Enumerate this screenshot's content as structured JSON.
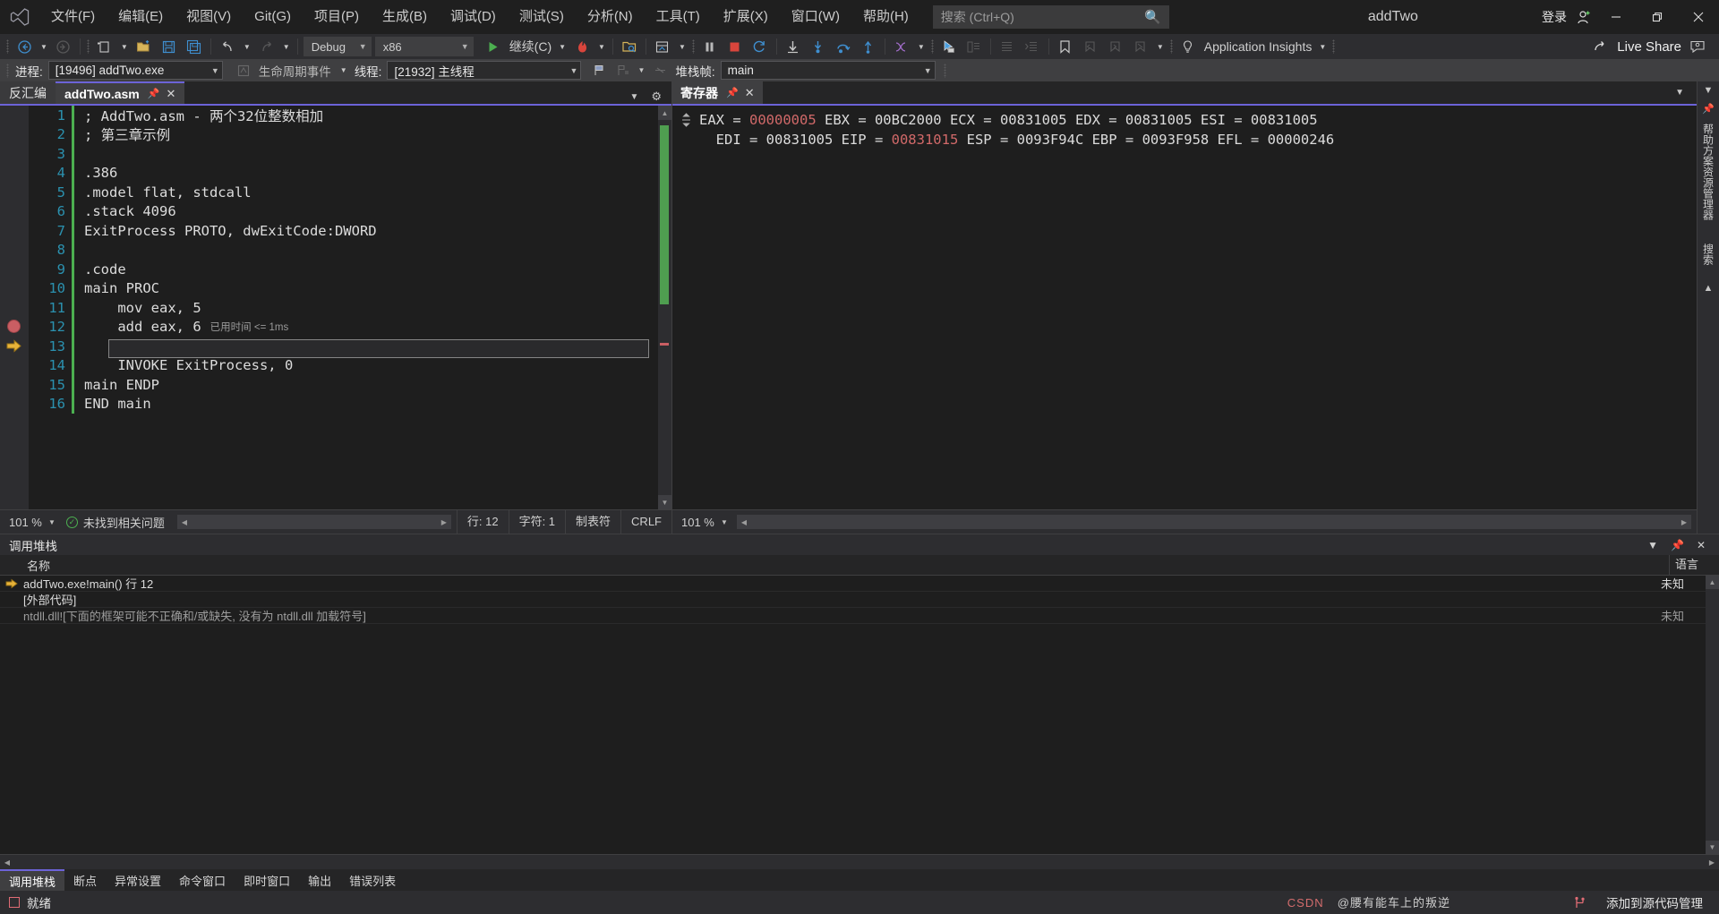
{
  "titlebar": {
    "logo_icon": "visual-studio-logo",
    "menus": [
      "文件(F)",
      "编辑(E)",
      "视图(V)",
      "Git(G)",
      "项目(P)",
      "生成(B)",
      "调试(D)",
      "测试(S)",
      "分析(N)",
      "工具(T)",
      "扩展(X)",
      "窗口(W)",
      "帮助(H)"
    ],
    "search_placeholder": "搜索 (Ctrl+Q)",
    "search_icon": "search-icon",
    "window_title": "addTwo",
    "signin_label": "登录",
    "signin_icon": "add-user-icon",
    "minimize_icon": "minimize-icon",
    "restore_icon": "restore-icon",
    "close_icon": "close-icon"
  },
  "toolbar": {
    "nav_back_icon": "navigate-back-icon",
    "nav_forward_icon": "navigate-forward-icon",
    "new_item_icon": "new-item-icon",
    "open_icon": "open-file-icon",
    "save_icon": "save-icon",
    "save_all_icon": "save-all-icon",
    "undo_icon": "undo-icon",
    "redo_icon": "redo-icon",
    "config_value": "Debug",
    "platform_value": "x86",
    "continue_label": "继续(C)",
    "continue_icon": "play-icon",
    "hotreload_icon": "hot-reload-icon",
    "attach_icon": "attach-process-icon",
    "breakall_icon": "break-all-icon",
    "pause_icon": "pause-icon",
    "stop_icon": "stop-icon",
    "restart_icon": "restart-icon",
    "step_into_icon": "step-into-icon",
    "step_over_icon": "step-over-icon",
    "step_out_icon": "step-out-icon",
    "show_next_icon": "show-next-statement-icon",
    "threads_icon": "threads-icon",
    "cursor_icon": "select-element-icon",
    "live_visual_icon": "live-visual-tree-icon",
    "indent_icon": "indent-icon",
    "outdent_icon": "outdent-icon",
    "bookmark_icon": "bookmark-icon",
    "prev_bookmark_icon": "previous-bookmark-icon",
    "next_bookmark_icon": "next-bookmark-icon",
    "clear_bookmark_icon": "clear-bookmarks-icon",
    "app_insights_label": "Application Insights",
    "app_insights_icon": "lightbulb-icon",
    "live_share_label": "Live Share",
    "live_share_icon": "live-share-icon",
    "feedback_icon": "feedback-icon"
  },
  "debugbar": {
    "process_label": "进程:",
    "process_value": "[19496] addTwo.exe",
    "lifecycle_label": "生命周期事件",
    "lifecycle_icon": "lifecycle-events-icon",
    "thread_label": "线程:",
    "thread_value": "[21932] 主线程",
    "flag_icon": "flag-icon",
    "flag_list_icon": "flag-list-icon",
    "no_flag_icon": "no-flag-icon",
    "stackframe_label": "堆栈帧:",
    "stackframe_value": "main"
  },
  "editor": {
    "tabs": [
      {
        "label": "反汇编",
        "active": false
      },
      {
        "label": "addTwo.asm",
        "active": true,
        "pin_icon": "pin-icon",
        "close_icon": "close-icon"
      }
    ],
    "tab_dropdown_icon": "chevron-down-icon",
    "tab_settings_icon": "gear-icon",
    "lines": [
      {
        "n": "1",
        "text": "; AddTwo.asm - 两个32位整数相加",
        "changed": true
      },
      {
        "n": "2",
        "text": "; 第三章示例",
        "changed": true
      },
      {
        "n": "3",
        "text": "",
        "changed": true
      },
      {
        "n": "4",
        "text": ".386",
        "changed": true
      },
      {
        "n": "5",
        "text": ".model flat, stdcall",
        "changed": true
      },
      {
        "n": "6",
        "text": ".stack 4096",
        "changed": true
      },
      {
        "n": "7",
        "text": "ExitProcess PROTO, dwExitCode:DWORD",
        "changed": true
      },
      {
        "n": "8",
        "text": "",
        "changed": true
      },
      {
        "n": "9",
        "text": ".code",
        "changed": true
      },
      {
        "n": "10",
        "text": "main PROC",
        "changed": true
      },
      {
        "n": "11",
        "text": "    mov eax, 5",
        "changed": true,
        "breakpoint": true
      },
      {
        "n": "12",
        "text": "    add eax, 6",
        "changed": true,
        "current": true,
        "annotation": "已用时间 <= 1ms"
      },
      {
        "n": "13",
        "text": "",
        "changed": true
      },
      {
        "n": "14",
        "text": "    INVOKE ExitProcess, 0",
        "changed": true
      },
      {
        "n": "15",
        "text": "main ENDP",
        "changed": true
      },
      {
        "n": "16",
        "text": "END main",
        "changed": true
      }
    ],
    "breakpoint_icon": "breakpoint-icon",
    "current_statement_icon": "current-statement-arrow-icon",
    "status": {
      "zoom": "101 %",
      "zoom_arrow_icon": "chevron-down-icon",
      "problems": "未找到相关问题",
      "problems_icon": "check-circle-icon",
      "line": "行: 12",
      "column": "字符: 1",
      "tabs_mode": "制表符",
      "eol": "CRLF"
    }
  },
  "registers": {
    "tab_label": "寄存器",
    "pin_icon": "pin-icon",
    "close_icon": "close-icon",
    "dropdown_icon": "chevron-down-icon",
    "line1_pre": "EAX = ",
    "line1_eax": "00000005",
    "line1_post": " EBX = 00BC2000 ECX = 00831005 EDX = 00831005 ESI = 00831005",
    "line2_pre": "  EDI = 00831005 EIP = ",
    "line2_eip": "00831015",
    "line2_post": " ESP = 0093F94C EBP = 0093F958 EFL = 00000246",
    "resize_icon": "resize-grip-icon",
    "zoom": "101 %",
    "zoom_arrow_icon": "chevron-down-icon"
  },
  "right_dock": {
    "tabs": [
      "帮助方案资源管理器",
      "搜索"
    ],
    "collapse_icon": "chevron-down-icon",
    "pin_icon": "pin-icon",
    "up_icon": "chevron-up-icon"
  },
  "callstack": {
    "panel_title": "调用堆栈",
    "minimize_icon": "chevron-down-icon",
    "pin_icon": "pin-icon",
    "close_icon": "close-icon",
    "columns": [
      "名称",
      "语言"
    ],
    "rows": [
      {
        "name": "addTwo.exe!main() 行 12",
        "lang": "未知",
        "current": true
      },
      {
        "name": "[外部代码]",
        "lang": "",
        "current": false
      },
      {
        "name": "ntdll.dll![下面的框架可能不正确和/或缺失, 没有为 ntdll.dll 加载符号]",
        "lang": "未知",
        "current": false,
        "dim": true
      }
    ],
    "current_icon": "current-frame-arrow-icon"
  },
  "dock_tabs": [
    {
      "label": "调用堆栈",
      "active": true
    },
    {
      "label": "断点",
      "active": false
    },
    {
      "label": "异常设置",
      "active": false
    },
    {
      "label": "命令窗口",
      "active": false
    },
    {
      "label": "即时窗口",
      "active": false
    },
    {
      "label": "输出",
      "active": false
    },
    {
      "label": "错误列表",
      "active": false
    }
  ],
  "statusbar": {
    "state": "就绪",
    "state_icon": "stop-square-icon",
    "add_to_source_control": "添加到源代码管理",
    "source_control_icon": "source-control-icon",
    "watermark_left": "CSDN",
    "watermark_right": "@腰有能车上的叛逆"
  },
  "colors": {
    "accent_purple": "#6c63d8",
    "line_number": "#2b91af",
    "changed_bar_green": "#4caf50",
    "breakpoint_red": "#c95e63",
    "register_highlight_red": "#d16969",
    "play_green": "#4caf50",
    "titlebar_bg": "#1f1f1f",
    "toolbar_bg": "#2d2d30",
    "debugbar_bg": "#3f3f41",
    "editor_bg": "#1e1e1e"
  }
}
